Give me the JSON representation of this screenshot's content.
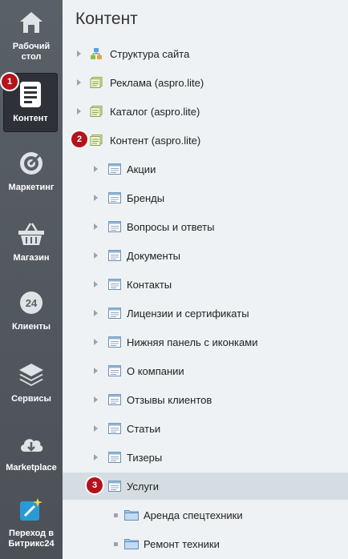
{
  "sidebar": {
    "items": [
      {
        "label": "Рабочий стол",
        "icon": "home-icon"
      },
      {
        "label": "Контент",
        "icon": "document-icon"
      },
      {
        "label": "Маркетинг",
        "icon": "target-icon"
      },
      {
        "label": "Магазин",
        "icon": "basket-icon"
      },
      {
        "label": "Клиенты",
        "icon": "clients-24-icon"
      },
      {
        "label": "Сервисы",
        "icon": "layers-icon"
      },
      {
        "label": "Marketplace",
        "icon": "cloud-download-icon"
      },
      {
        "label": "Переход в Битрикс24",
        "icon": "magic-wand-icon"
      }
    ]
  },
  "main": {
    "title": "Контент",
    "tree": [
      {
        "label": "Структура сайта",
        "level": 0,
        "icon": "site-structure-icon"
      },
      {
        "label": "Реклама (aspro.lite)",
        "level": 0,
        "icon": "iblock-type-icon"
      },
      {
        "label": "Каталог (aspro.lite)",
        "level": 0,
        "icon": "iblock-type-icon"
      },
      {
        "label": "Контент (aspro.lite)",
        "level": 0,
        "icon": "iblock-type-icon"
      },
      {
        "label": "Акции",
        "level": 1,
        "icon": "iblock-icon"
      },
      {
        "label": "Бренды",
        "level": 1,
        "icon": "iblock-icon"
      },
      {
        "label": "Вопросы и ответы",
        "level": 1,
        "icon": "iblock-icon"
      },
      {
        "label": "Документы",
        "level": 1,
        "icon": "iblock-icon"
      },
      {
        "label": "Контакты",
        "level": 1,
        "icon": "iblock-icon"
      },
      {
        "label": "Лицензии и сертификаты",
        "level": 1,
        "icon": "iblock-icon"
      },
      {
        "label": "Нижняя панель с иконками",
        "level": 1,
        "icon": "iblock-icon"
      },
      {
        "label": "О компании",
        "level": 1,
        "icon": "iblock-icon"
      },
      {
        "label": "Отзывы клиентов",
        "level": 1,
        "icon": "iblock-icon"
      },
      {
        "label": "Статьи",
        "level": 1,
        "icon": "iblock-icon"
      },
      {
        "label": "Тизеры",
        "level": 1,
        "icon": "iblock-icon"
      },
      {
        "label": "Услуги",
        "level": 1,
        "icon": "iblock-icon"
      },
      {
        "label": "Аренда спецтехники",
        "level": 2,
        "icon": "folder-icon"
      },
      {
        "label": "Ремонт техники",
        "level": 2,
        "icon": "folder-icon"
      }
    ]
  },
  "badges": [
    "1",
    "2",
    "3"
  ],
  "colors": {
    "badge": "#b3141c",
    "rail": "#53585f",
    "selected_row": "#d5dde2"
  }
}
